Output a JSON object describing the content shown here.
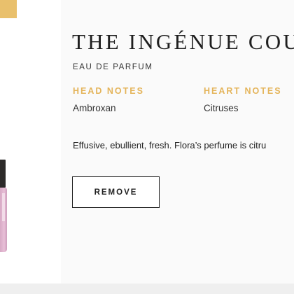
{
  "product": {
    "title": "THE INGÉNUE COU",
    "subtitle": "EAU DE PARFUM",
    "notes": [
      {
        "header": "HEAD NOTES",
        "value": "Ambroxan"
      },
      {
        "header": "HEART NOTES",
        "value": "Citruses"
      }
    ],
    "description": "Effusive, ebullient, fresh. Flora’s perfume is citru"
  },
  "actions": {
    "remove_label": "REMOVE"
  },
  "colors": {
    "accent_gold": "#e9c06c",
    "notes_header": "#e4b45a",
    "vial_pink": "#e8bfd7",
    "vial_cap": "#2c2a29"
  },
  "icons": {
    "thumbnail": "perfume-vial-icon"
  }
}
